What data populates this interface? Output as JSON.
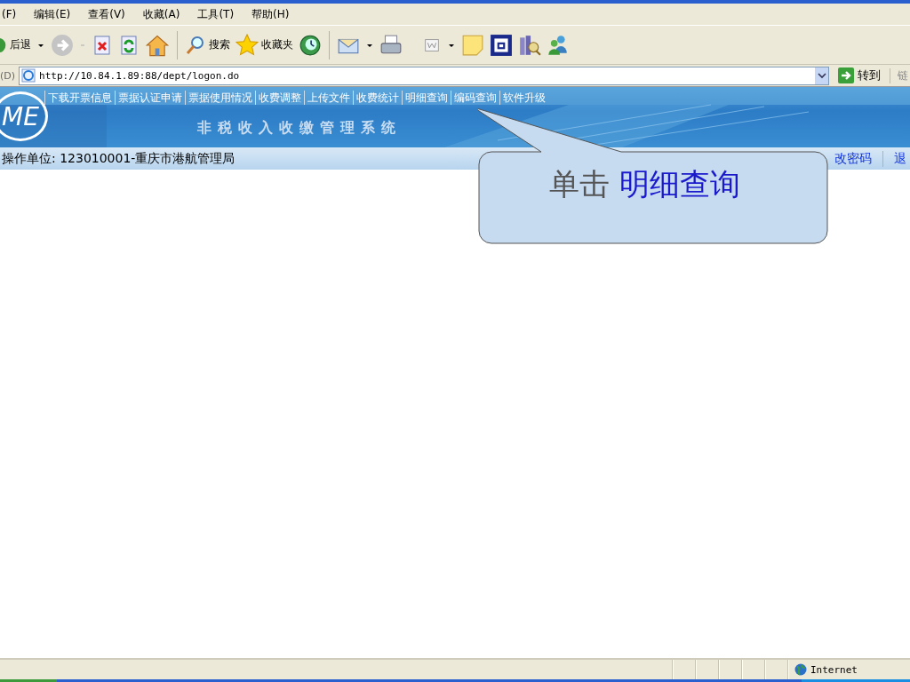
{
  "menu_bar": [
    "(F)",
    "编辑(E)",
    "查看(V)",
    "收藏(A)",
    "工具(T)",
    "帮助(H)"
  ],
  "toolbar": {
    "back_label": "后退",
    "search_label": "搜索",
    "favorites_label": "收藏夹"
  },
  "address_bar": {
    "label": "(D)",
    "url": "http://10.84.1.89:88/dept/logon.do",
    "go_label": "转到",
    "links_label": "链"
  },
  "banner": {
    "logo": "ME",
    "title": "非税收入收缴管理系统",
    "nav": [
      "下载开票信息",
      "票据认证申请",
      "票据使用情况",
      "收费调整",
      "上传文件",
      "收费统计",
      "明细查询",
      "编码查询",
      "软件升级"
    ]
  },
  "user_row": {
    "unit": "操作单位: 123010001-重庆市港航管理局",
    "links": [
      "改密码",
      "退"
    ]
  },
  "callout": {
    "prefix": "单击",
    "highlight": "明细查询"
  },
  "status_bar": {
    "zone": "Internet"
  }
}
